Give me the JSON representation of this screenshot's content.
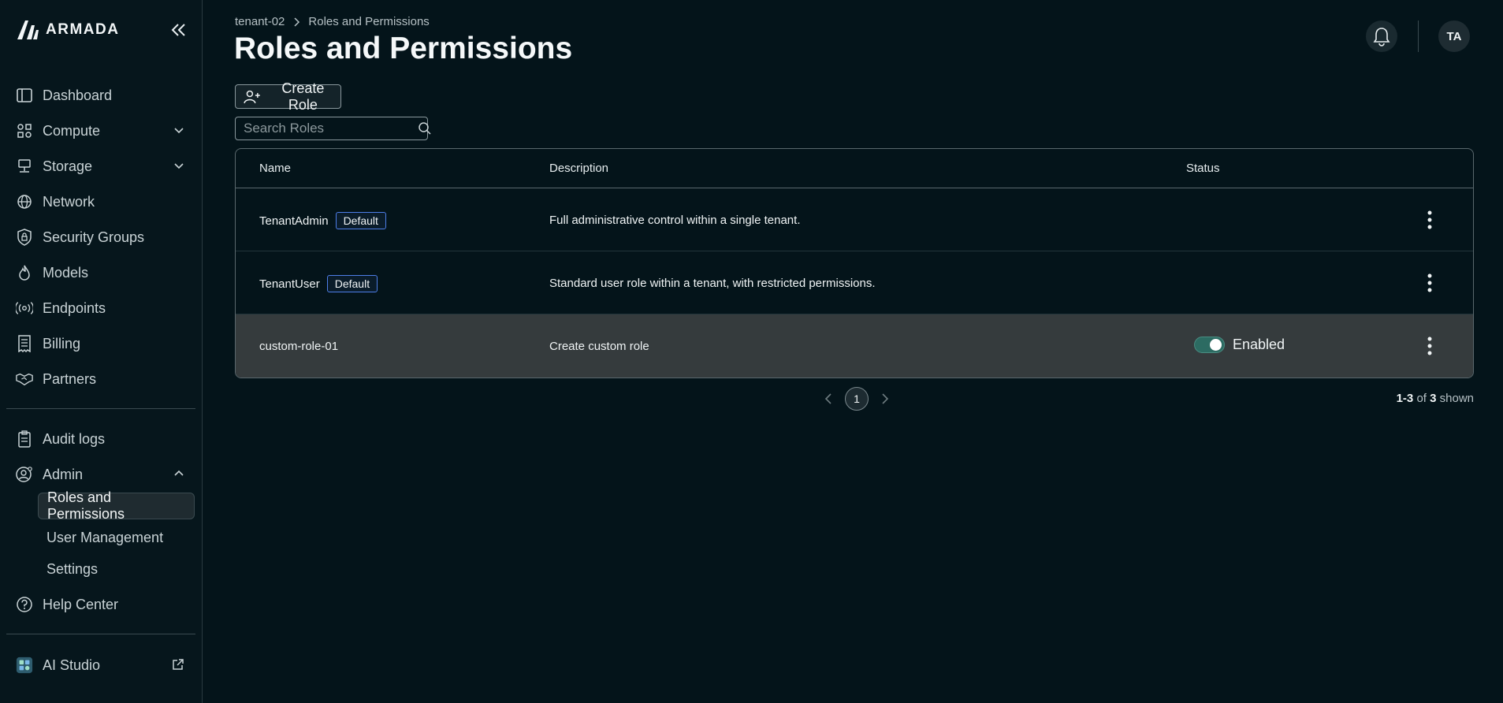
{
  "brand": {
    "name": "ARMADA"
  },
  "sidebar": {
    "items": [
      {
        "label": "Dashboard",
        "icon": "sidebar-panel-icon"
      },
      {
        "label": "Compute",
        "icon": "compute-icon",
        "expandable": true
      },
      {
        "label": "Storage",
        "icon": "storage-icon",
        "expandable": true
      },
      {
        "label": "Network",
        "icon": "globe-icon"
      },
      {
        "label": "Security Groups",
        "icon": "shield-lock-icon"
      },
      {
        "label": "Models",
        "icon": "flame-icon"
      },
      {
        "label": "Endpoints",
        "icon": "broadcast-icon"
      },
      {
        "label": "Billing",
        "icon": "receipt-icon"
      },
      {
        "label": "Partners",
        "icon": "handshake-icon"
      }
    ],
    "secondary": [
      {
        "label": "Audit logs",
        "icon": "clipboard-icon"
      },
      {
        "label": "Admin",
        "icon": "user-gear-icon",
        "expanded": true
      }
    ],
    "admin_sub": [
      {
        "label": "Roles and Permissions",
        "active": true
      },
      {
        "label": "User Management"
      },
      {
        "label": "Settings"
      }
    ],
    "help": {
      "label": "Help Center",
      "icon": "question-circle-icon"
    },
    "studio": {
      "label": "AI Studio",
      "icon": "ai-studio-icon"
    }
  },
  "header": {
    "breadcrumb": [
      "tenant-02",
      "Roles and Permissions"
    ],
    "title": "Roles and Permissions",
    "avatar_initials": "TA"
  },
  "toolbar": {
    "create_label": "Create Role",
    "search_placeholder": "Search Roles"
  },
  "table": {
    "columns": {
      "name": "Name",
      "description": "Description",
      "status": "Status"
    },
    "rows": [
      {
        "name": "TenantAdmin",
        "badge": "Default",
        "description": "Full administrative control within a single tenant.",
        "status": ""
      },
      {
        "name": "TenantUser",
        "badge": "Default",
        "description": "Standard user role within a tenant, with restricted permissions.",
        "status": ""
      },
      {
        "name": "custom-role-01",
        "badge": "",
        "description": "Create custom role",
        "status": "Enabled",
        "enabled": true
      }
    ]
  },
  "pagination": {
    "current_page": "1",
    "range": "1-3",
    "of_label": "of",
    "total": "3",
    "shown_label": "shown"
  },
  "colors": {
    "background": "#04141a",
    "badge_border": "#4d7ee8",
    "toggle_on": "#2c6b62"
  }
}
